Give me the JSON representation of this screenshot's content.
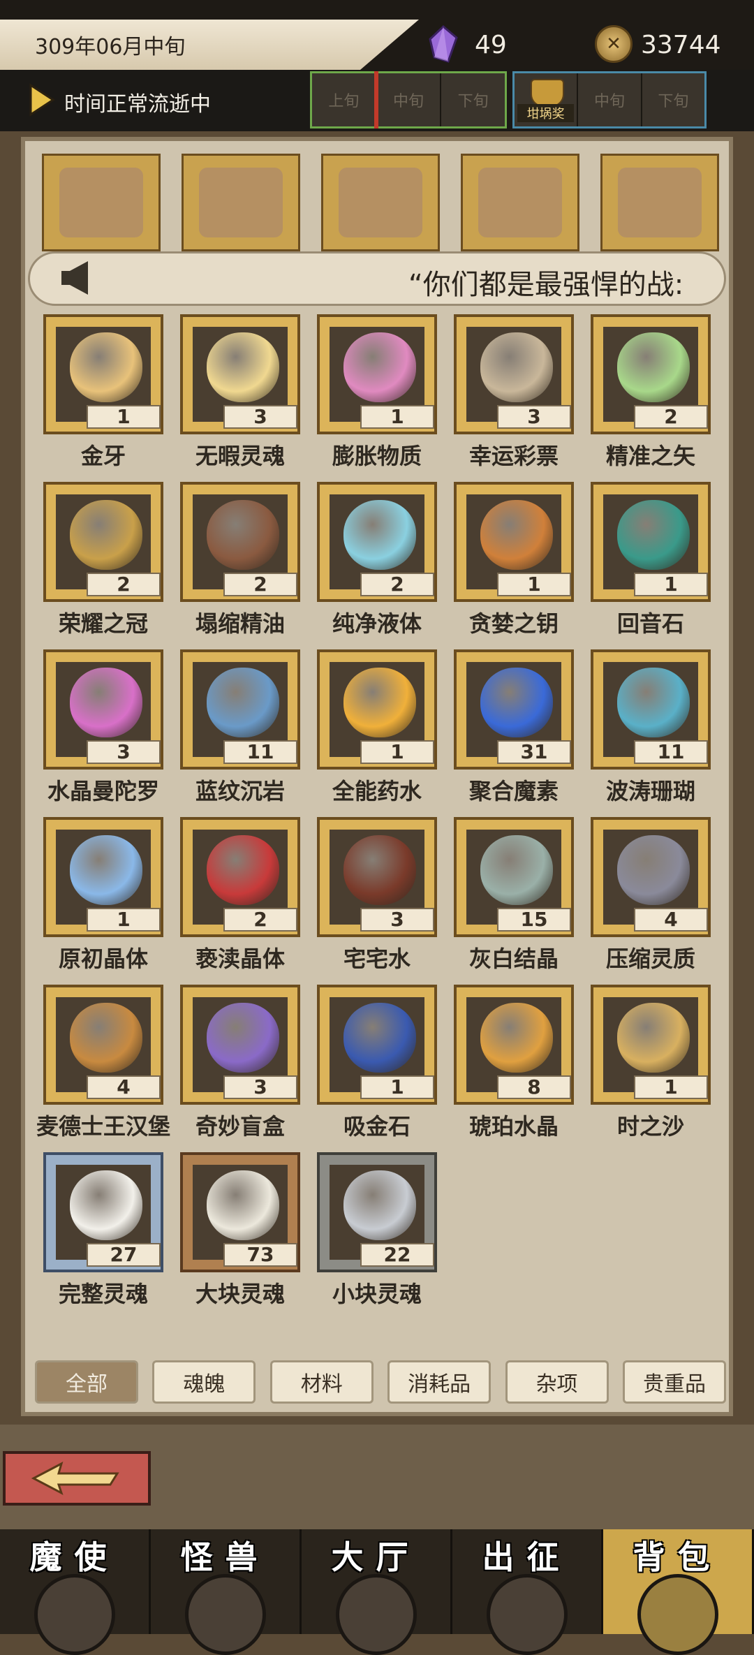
{
  "header": {
    "date": "309年06月中旬",
    "gems": "49",
    "coins": "33744",
    "time_status": "时间正常流逝中",
    "periods_left": [
      "上旬",
      "中旬",
      "下旬"
    ],
    "periods_right": [
      "",
      "中旬",
      "下旬"
    ],
    "pot_label": "坩埚奖"
  },
  "news": {
    "text": "“你们都是最强悍的战:"
  },
  "items": [
    {
      "name": "金牙",
      "count": "1",
      "frame": "gold",
      "color": "#e8c27a"
    },
    {
      "name": "无暇灵魂",
      "count": "3",
      "frame": "gold",
      "color": "#f0d890"
    },
    {
      "name": "膨胀物质",
      "count": "1",
      "frame": "gold",
      "color": "#e08ac0"
    },
    {
      "name": "幸运彩票",
      "count": "3",
      "frame": "gold",
      "color": "#c9b79a"
    },
    {
      "name": "精准之矢",
      "count": "2",
      "frame": "gold",
      "color": "#a8d88a"
    },
    {
      "name": "荣耀之冠",
      "count": "2",
      "frame": "gold",
      "color": "#c9a04a"
    },
    {
      "name": "塌缩精油",
      "count": "2",
      "frame": "gold",
      "color": "#8a5a40"
    },
    {
      "name": "纯净液体",
      "count": "2",
      "frame": "gold",
      "color": "#8ad0e0"
    },
    {
      "name": "贪婪之钥",
      "count": "1",
      "frame": "gold",
      "color": "#d0803a"
    },
    {
      "name": "回音石",
      "count": "1",
      "frame": "gold",
      "color": "#3a9a8a"
    },
    {
      "name": "水晶曼陀罗",
      "count": "3",
      "frame": "gold",
      "color": "#d870c8"
    },
    {
      "name": "蓝纹沉岩",
      "count": "11",
      "frame": "gold",
      "color": "#6a9ac8"
    },
    {
      "name": "全能药水",
      "count": "1",
      "frame": "gold",
      "color": "#f0b03a"
    },
    {
      "name": "聚合魔素",
      "count": "31",
      "frame": "gold",
      "color": "#3a6ad8"
    },
    {
      "name": "波涛珊瑚",
      "count": "11",
      "frame": "gold",
      "color": "#5ab0c8"
    },
    {
      "name": "原初晶体",
      "count": "1",
      "frame": "gold",
      "color": "#8ab8e8"
    },
    {
      "name": "亵渎晶体",
      "count": "2",
      "frame": "gold",
      "color": "#c83a3a"
    },
    {
      "name": "宅宅水",
      "count": "3",
      "frame": "gold",
      "color": "#7a3a2a"
    },
    {
      "name": "灰白结晶",
      "count": "15",
      "frame": "gold",
      "color": "#9ab0a8"
    },
    {
      "name": "压缩灵质",
      "count": "4",
      "frame": "gold",
      "color": "#8a8a9a"
    },
    {
      "name": "麦德士王汉堡",
      "count": "4",
      "frame": "gold",
      "color": "#c88a40"
    },
    {
      "name": "奇妙盲盒",
      "count": "3",
      "frame": "gold",
      "color": "#8a6ac8"
    },
    {
      "name": "吸金石",
      "count": "1",
      "frame": "gold",
      "color": "#3a5ab0"
    },
    {
      "name": "琥珀水晶",
      "count": "8",
      "frame": "gold",
      "color": "#e0a040"
    },
    {
      "name": "时之沙",
      "count": "1",
      "frame": "gold",
      "color": "#d8b060"
    },
    {
      "name": "完整灵魂",
      "count": "27",
      "frame": "silver",
      "color": "#f2f0ea"
    },
    {
      "name": "大块灵魂",
      "count": "73",
      "frame": "bronze",
      "color": "#ece8dc"
    },
    {
      "name": "小块灵魂",
      "count": "22",
      "frame": "gray",
      "color": "#c8ccd2"
    }
  ],
  "tabs": [
    "全部",
    "魂魄",
    "材料",
    "消耗品",
    "杂项",
    "贵重品"
  ],
  "nav": [
    "魔使",
    "怪兽",
    "大厅",
    "出征",
    "背包"
  ],
  "colors": {
    "gold_frame": "#dcb45a",
    "active_tab": "#9c8565",
    "back_button": "#c45850"
  }
}
